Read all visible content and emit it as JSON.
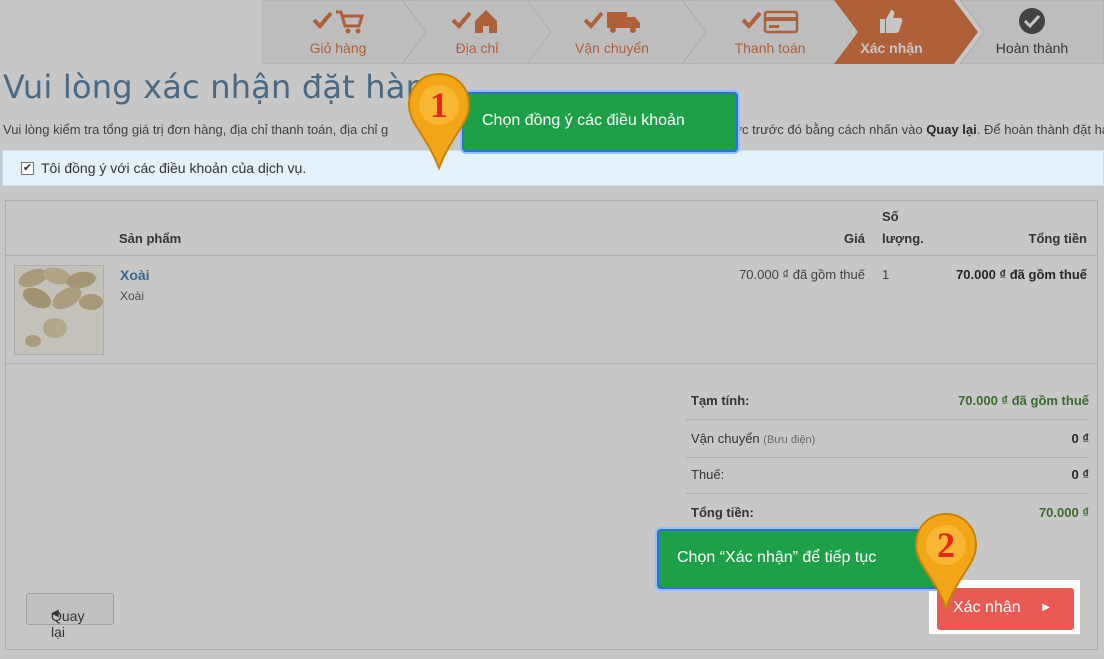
{
  "steps": [
    {
      "label": "Giỏ hàng",
      "icon": "cart-icon"
    },
    {
      "label": "Địa chỉ",
      "icon": "home-icon"
    },
    {
      "label": "Vận chuyển",
      "icon": "truck-icon"
    },
    {
      "label": "Thanh toán",
      "icon": "card-icon"
    },
    {
      "label": "Xác nhận",
      "icon": "thumbs-up-icon"
    },
    {
      "label": "Hoàn thành",
      "icon": "check-circle-icon"
    }
  ],
  "page": {
    "title": "Vui lòng xác nhận đặt hàng",
    "intro_part1": "Vui lòng kiểm tra tổng giá trị đơn hàng, địa chỉ thanh toán, địa chỉ g",
    "intro_part2": "ể quay lại bước trước đó bằng cách nhấn vào ",
    "intro_back": "Quay lại",
    "intro_part3": ". Để hoàn thành đặt hàng bằ",
    "agree_text": "Tôi đồng ý với các điều khoản của dịch vụ."
  },
  "table": {
    "headers": {
      "product": "Sản phẩm",
      "price": "Giá",
      "qty_line1": "Số",
      "qty_line2": "lượng.",
      "total": "Tổng tiền"
    },
    "rows": [
      {
        "name": "Xoài",
        "sub": "Xoài",
        "price": "70.000 ₫ đã gồm thuế",
        "qty": "1",
        "total": "70.000 ₫ đã gồm thuế"
      }
    ]
  },
  "summary": {
    "subtotal_label": "Tạm tính:",
    "subtotal_value": "70.000 ₫ đã gồm thuế",
    "shipping_label": "Vận chuyển",
    "shipping_note": "(Bưu điện)",
    "shipping_value": "0 ₫",
    "tax_label": "Thuế:",
    "tax_value": "0 ₫",
    "total_label": "Tổng tiền:",
    "total_value": "70.000 ₫"
  },
  "buttons": {
    "back": "Quay lại",
    "confirm": "Xác nhận"
  },
  "callouts": {
    "one_num": "1",
    "one_text": "Chọn đồng ý các điều khoản",
    "two_num": "2",
    "two_text": "Chọn “Xác nhận” để tiếp tục"
  },
  "colors": {
    "accent": "#e07b4a",
    "confirm": "#e9524f",
    "callout": "#1ea048"
  }
}
